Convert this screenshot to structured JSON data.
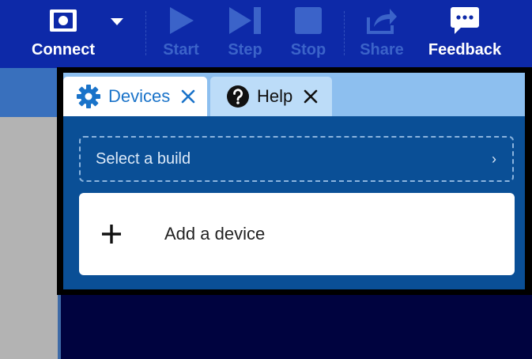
{
  "toolbar": {
    "connect": "Connect",
    "start": "Start",
    "step": "Step",
    "stop": "Stop",
    "share": "Share",
    "feedback": "Feedback"
  },
  "dialog": {
    "tabs": [
      {
        "label": "Devices",
        "icon": "gear-icon"
      },
      {
        "label": "Help",
        "icon": "question-circle-icon"
      }
    ],
    "build_select": {
      "label": "Select a build",
      "chevron": "›"
    },
    "add_device": {
      "label": "Add a device"
    }
  },
  "colors": {
    "toolbar": "#0d29a8",
    "tab_active_text": "#1a73c9",
    "panel": "#0a4f96",
    "tabbar": "#8dbfef"
  }
}
